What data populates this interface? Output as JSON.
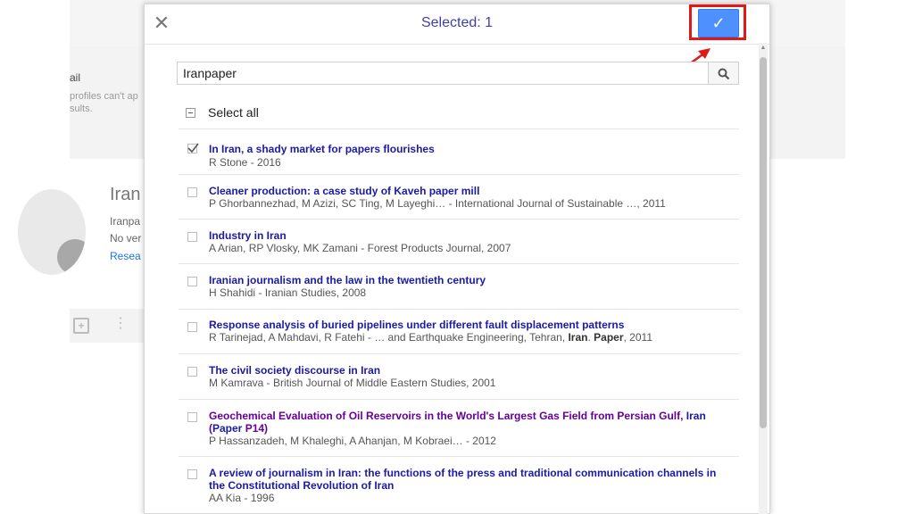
{
  "background": {
    "band_title": "ail",
    "band_line1": "profiles can't ap",
    "band_line2": "sults.",
    "profile_name": "Iran",
    "profile_sub1": "Iranpa",
    "profile_sub2": "No ver",
    "profile_link": "Resea"
  },
  "dialog": {
    "title": "Selected: 1",
    "close_glyph": "✕",
    "confirm_glyph": "✓"
  },
  "search": {
    "value": "Iranpaper"
  },
  "select_all_label": "Select all",
  "articles": [
    {
      "title": "In Iran, a shady market for papers flourishes",
      "meta": "R Stone - 2016"
    },
    {
      "title": "Cleaner production: a case study of Kaveh paper mill",
      "meta": "P Ghorbannezhad, M Azizi, SC Ting, M Layeghi… - International Journal of Sustainable …, 2011"
    },
    {
      "title": "Industry in Iran",
      "meta": "A Arian, RP Vlosky, MK Zamani - Forest Products Journal, 2007"
    },
    {
      "title": "Iranian journalism and the law in the twentieth century",
      "meta": "H Shahidi - Iranian Studies, 2008"
    },
    {
      "title": "Response analysis of buried pipelines under different fault displacement patterns",
      "meta_pre": "R Tarinejad, A Mahdavi, R Fatehi - … and Earthquake Engineering, Tehran, ",
      "meta_b1": "Iran",
      "meta_mid": ". ",
      "meta_b2": "Paper",
      "meta_post": ", 2011"
    },
    {
      "title": "The civil society discourse in Iran",
      "meta": "M Kamrava - British Journal of Middle Eastern Studies, 2001"
    },
    {
      "title_pre": "Geochemical Evaluation of Oil Reservoirs in the World's Largest Gas Field from Persian Gulf, ",
      "title_b1": "Iran",
      "title_mid": " (",
      "title_b2": "Paper",
      "title_post": " P14)",
      "meta": "P Hassanzadeh, M Khaleghi, A Ahanjan, M Kobraei… - 2012"
    },
    {
      "title": "A review of journalism in Iran: the functions of the press and traditional communication channels in the Constitutional Revolution of Iran",
      "meta": "AA Kia - 1996"
    }
  ],
  "colors": {
    "confirm": "#4d90fe",
    "highlight": "#e01818",
    "title_link": "#1a1aa6",
    "visited_link": "#660099"
  }
}
